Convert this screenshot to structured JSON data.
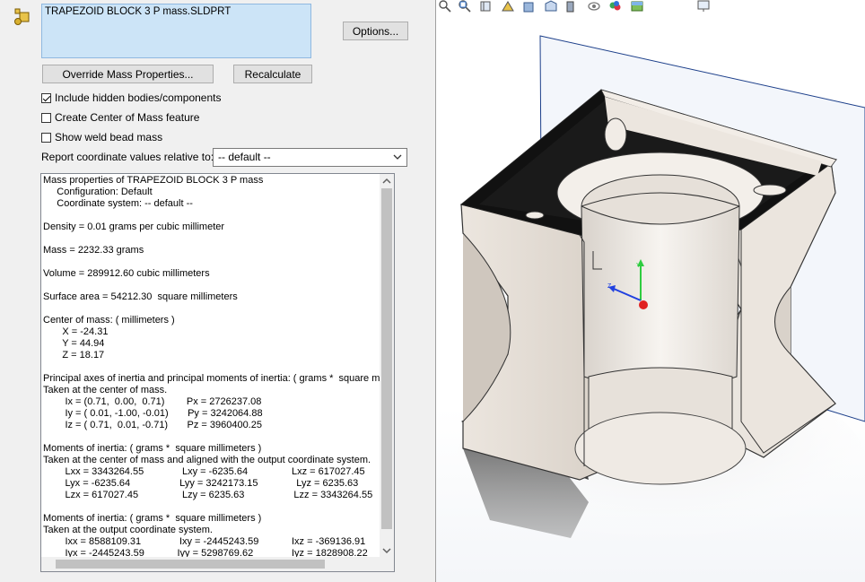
{
  "selection": {
    "file_name": "TRAPEZOID BLOCK 3 P mass.SLDPRT"
  },
  "buttons": {
    "options": "Options...",
    "override": "Override Mass Properties...",
    "recalculate": "Recalculate"
  },
  "checks": {
    "hidden": {
      "label": "Include hidden bodies/components",
      "checked": true
    },
    "com": {
      "label": "Create Center of Mass feature",
      "checked": false
    },
    "weld": {
      "label": "Show weld bead mass",
      "checked": false
    }
  },
  "coord": {
    "label": "Report coordinate values relative to:",
    "value": "-- default --"
  },
  "results": {
    "lines": [
      "Mass properties of TRAPEZOID BLOCK 3 P mass",
      "     Configuration: Default",
      "     Coordinate system: -- default --",
      "",
      "Density = 0.01 grams per cubic millimeter",
      "",
      "Mass = 2232.33 grams",
      "",
      "Volume = 289912.60 cubic millimeters",
      "",
      "Surface area = 54212.30  square millimeters",
      "",
      "Center of mass: ( millimeters )",
      "       X = -24.31",
      "       Y = 44.94",
      "       Z = 18.17",
      "",
      "Principal axes of inertia and principal moments of inertia: ( grams *  square millimeters )",
      "Taken at the center of mass.",
      "        Ix = (0.71,  0.00,  0.71)        Px = 2726237.08",
      "        Iy = ( 0.01, -1.00, -0.01)       Py = 3242064.88",
      "        Iz = ( 0.71,  0.01, -0.71)       Pz = 3960400.25",
      "",
      "Moments of inertia: ( grams *  square millimeters )",
      "Taken at the center of mass and aligned with the output coordinate system.",
      "        Lxx = 3343264.55              Lxy = -6235.64                Lxz = 617027.45",
      "        Lyx = -6235.64                  Lyy = 3242173.15              Lyz = 6235.63",
      "        Lzx = 617027.45                Lzy = 6235.63                  Lzz = 3343264.55",
      "",
      "Moments of inertia: ( grams *  square millimeters )",
      "Taken at the output coordinate system.",
      "        Ixx = 8588109.31              Ixy = -2445243.59            Ixz = -369136.91",
      "        Iyx = -2445243.59            Iyy = 5298769.62              Iyz = 1828908.22"
    ]
  },
  "colors": {
    "selection_bg": "#cce4f7",
    "panel_bg": "#f0f0f0",
    "axis_y": "#2ecc40",
    "axis_x": "#e02020",
    "axis_z": "#2040e0"
  },
  "toolbar_icons": [
    "search-icon",
    "zoom-area-icon",
    "previous-view-icon",
    "section-view-icon",
    "dynamic-annotation-icon",
    "view-orientation-icon",
    "display-style-icon",
    "hide-show-icon",
    "edit-appearance-icon",
    "apply-scene-icon",
    "view-settings-icon"
  ]
}
